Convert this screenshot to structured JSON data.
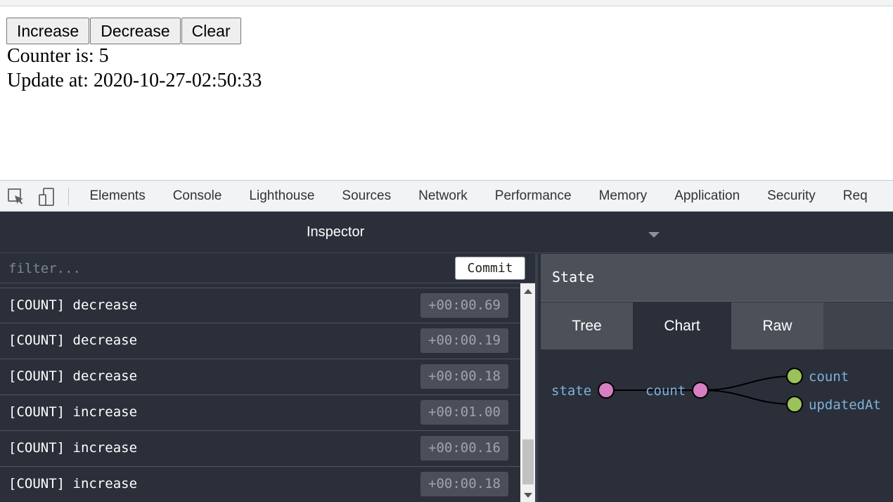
{
  "app": {
    "buttons": {
      "increase": "Increase",
      "decrease": "Decrease",
      "clear": "Clear"
    },
    "counter_line": "Counter is: 5",
    "update_line": "Update at: 2020-10-27-02:50:33"
  },
  "devtools": {
    "tabs": [
      "Elements",
      "Console",
      "Lighthouse",
      "Sources",
      "Network",
      "Performance",
      "Memory",
      "Application",
      "Security",
      "Req"
    ],
    "icons": {
      "inspect": "inspect-element-icon",
      "device": "device-toolbar-icon"
    }
  },
  "inspector": {
    "title": "Inspector",
    "filter_placeholder": "filter...",
    "commit_label": "Commit",
    "actions": [
      {
        "name": "[COUNT] decrease",
        "time": "+00:00.69"
      },
      {
        "name": "[COUNT] decrease",
        "time": "+00:00.19"
      },
      {
        "name": "[COUNT] decrease",
        "time": "+00:00.18"
      },
      {
        "name": "[COUNT] increase",
        "time": "+00:01.00"
      },
      {
        "name": "[COUNT] increase",
        "time": "+00:00.16"
      },
      {
        "name": "[COUNT] increase",
        "time": "+00:00.18"
      }
    ]
  },
  "state_panel": {
    "title": "State",
    "tabs": {
      "tree": "Tree",
      "chart": "Chart",
      "raw": "Raw"
    },
    "active_tab": "Chart",
    "graph": {
      "root": "state",
      "child": "count",
      "leaves": [
        "count",
        "updatedAt"
      ]
    },
    "colors": {
      "branch_node": "#d67fc3",
      "leaf_node": "#9bc25a",
      "label": "#7fb1d9"
    }
  }
}
